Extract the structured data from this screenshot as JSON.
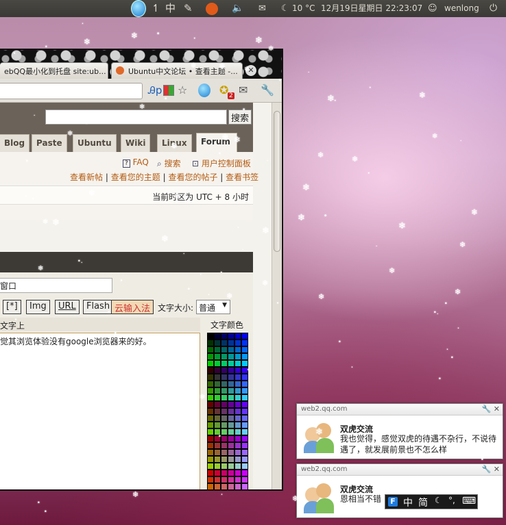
{
  "panel": {
    "input_method": "中",
    "weather": "10 °C",
    "datetime": "12月19日星期日 22:23:07",
    "user": "wenlong"
  },
  "browser": {
    "tabs": [
      {
        "label": "ebQQ最小化到托盘 site:ub..."
      },
      {
        "label": "Ubuntu中文论坛 • 查看主题 -..."
      }
    ],
    "toolbar": {
      "mail_badge": "2"
    },
    "site": {
      "search_button": "搜索",
      "nav_tabs": [
        "Blog",
        "Paste",
        "Ubuntu",
        "Wiki",
        "Linux",
        "Forum"
      ],
      "links_top": [
        "FAQ",
        "搜索",
        "用户控制面板"
      ],
      "links_bottom": [
        "查看新帖",
        "查看您的主题",
        "查看您的帖子",
        "查看书签"
      ],
      "separator": "|",
      "timezone": "当前时区为 UTC + 8 小时",
      "subject_value": "窗口",
      "bbcode_buttons": [
        "[*]",
        "Img",
        "URL",
        "Flash",
        "云输入法"
      ],
      "font_size_label": "文字大小:",
      "font_size_value": "普通",
      "textarea_header": "文字上",
      "textarea_value": "觉其浏览体验没有google浏览器来的好。",
      "color_label": "文字颜色"
    }
  },
  "notifications": [
    {
      "source": "web2.qq.com",
      "title": "双虎交流",
      "message": "我也觉得，感觉双虎的待遇不杂行，不说待遇了，就发展前景也不怎么样"
    },
    {
      "source": "web2.qq.com",
      "title": "双虎交流",
      "message": "恩相当不错"
    }
  ],
  "ime_bar": {
    "chinese": "中",
    "simplified": "简",
    "punct": "°,"
  },
  "colors": {
    "panel": "#3c3b37",
    "link": "#b35c13",
    "header": "#6b6259"
  }
}
